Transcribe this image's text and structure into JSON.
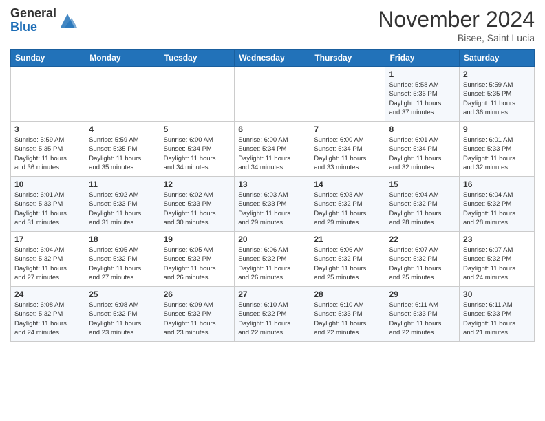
{
  "header": {
    "logo_line1": "General",
    "logo_line2": "Blue",
    "month_title": "November 2024",
    "subtitle": "Bisee, Saint Lucia"
  },
  "weekdays": [
    "Sunday",
    "Monday",
    "Tuesday",
    "Wednesday",
    "Thursday",
    "Friday",
    "Saturday"
  ],
  "weeks": [
    [
      {
        "day": "",
        "info": ""
      },
      {
        "day": "",
        "info": ""
      },
      {
        "day": "",
        "info": ""
      },
      {
        "day": "",
        "info": ""
      },
      {
        "day": "",
        "info": ""
      },
      {
        "day": "1",
        "info": "Sunrise: 5:58 AM\nSunset: 5:36 PM\nDaylight: 11 hours\nand 37 minutes."
      },
      {
        "day": "2",
        "info": "Sunrise: 5:59 AM\nSunset: 5:35 PM\nDaylight: 11 hours\nand 36 minutes."
      }
    ],
    [
      {
        "day": "3",
        "info": "Sunrise: 5:59 AM\nSunset: 5:35 PM\nDaylight: 11 hours\nand 36 minutes."
      },
      {
        "day": "4",
        "info": "Sunrise: 5:59 AM\nSunset: 5:35 PM\nDaylight: 11 hours\nand 35 minutes."
      },
      {
        "day": "5",
        "info": "Sunrise: 6:00 AM\nSunset: 5:34 PM\nDaylight: 11 hours\nand 34 minutes."
      },
      {
        "day": "6",
        "info": "Sunrise: 6:00 AM\nSunset: 5:34 PM\nDaylight: 11 hours\nand 34 minutes."
      },
      {
        "day": "7",
        "info": "Sunrise: 6:00 AM\nSunset: 5:34 PM\nDaylight: 11 hours\nand 33 minutes."
      },
      {
        "day": "8",
        "info": "Sunrise: 6:01 AM\nSunset: 5:34 PM\nDaylight: 11 hours\nand 32 minutes."
      },
      {
        "day": "9",
        "info": "Sunrise: 6:01 AM\nSunset: 5:33 PM\nDaylight: 11 hours\nand 32 minutes."
      }
    ],
    [
      {
        "day": "10",
        "info": "Sunrise: 6:01 AM\nSunset: 5:33 PM\nDaylight: 11 hours\nand 31 minutes."
      },
      {
        "day": "11",
        "info": "Sunrise: 6:02 AM\nSunset: 5:33 PM\nDaylight: 11 hours\nand 31 minutes."
      },
      {
        "day": "12",
        "info": "Sunrise: 6:02 AM\nSunset: 5:33 PM\nDaylight: 11 hours\nand 30 minutes."
      },
      {
        "day": "13",
        "info": "Sunrise: 6:03 AM\nSunset: 5:33 PM\nDaylight: 11 hours\nand 29 minutes."
      },
      {
        "day": "14",
        "info": "Sunrise: 6:03 AM\nSunset: 5:32 PM\nDaylight: 11 hours\nand 29 minutes."
      },
      {
        "day": "15",
        "info": "Sunrise: 6:04 AM\nSunset: 5:32 PM\nDaylight: 11 hours\nand 28 minutes."
      },
      {
        "day": "16",
        "info": "Sunrise: 6:04 AM\nSunset: 5:32 PM\nDaylight: 11 hours\nand 28 minutes."
      }
    ],
    [
      {
        "day": "17",
        "info": "Sunrise: 6:04 AM\nSunset: 5:32 PM\nDaylight: 11 hours\nand 27 minutes."
      },
      {
        "day": "18",
        "info": "Sunrise: 6:05 AM\nSunset: 5:32 PM\nDaylight: 11 hours\nand 27 minutes."
      },
      {
        "day": "19",
        "info": "Sunrise: 6:05 AM\nSunset: 5:32 PM\nDaylight: 11 hours\nand 26 minutes."
      },
      {
        "day": "20",
        "info": "Sunrise: 6:06 AM\nSunset: 5:32 PM\nDaylight: 11 hours\nand 26 minutes."
      },
      {
        "day": "21",
        "info": "Sunrise: 6:06 AM\nSunset: 5:32 PM\nDaylight: 11 hours\nand 25 minutes."
      },
      {
        "day": "22",
        "info": "Sunrise: 6:07 AM\nSunset: 5:32 PM\nDaylight: 11 hours\nand 25 minutes."
      },
      {
        "day": "23",
        "info": "Sunrise: 6:07 AM\nSunset: 5:32 PM\nDaylight: 11 hours\nand 24 minutes."
      }
    ],
    [
      {
        "day": "24",
        "info": "Sunrise: 6:08 AM\nSunset: 5:32 PM\nDaylight: 11 hours\nand 24 minutes."
      },
      {
        "day": "25",
        "info": "Sunrise: 6:08 AM\nSunset: 5:32 PM\nDaylight: 11 hours\nand 23 minutes."
      },
      {
        "day": "26",
        "info": "Sunrise: 6:09 AM\nSunset: 5:32 PM\nDaylight: 11 hours\nand 23 minutes."
      },
      {
        "day": "27",
        "info": "Sunrise: 6:10 AM\nSunset: 5:32 PM\nDaylight: 11 hours\nand 22 minutes."
      },
      {
        "day": "28",
        "info": "Sunrise: 6:10 AM\nSunset: 5:33 PM\nDaylight: 11 hours\nand 22 minutes."
      },
      {
        "day": "29",
        "info": "Sunrise: 6:11 AM\nSunset: 5:33 PM\nDaylight: 11 hours\nand 22 minutes."
      },
      {
        "day": "30",
        "info": "Sunrise: 6:11 AM\nSunset: 5:33 PM\nDaylight: 11 hours\nand 21 minutes."
      }
    ]
  ]
}
